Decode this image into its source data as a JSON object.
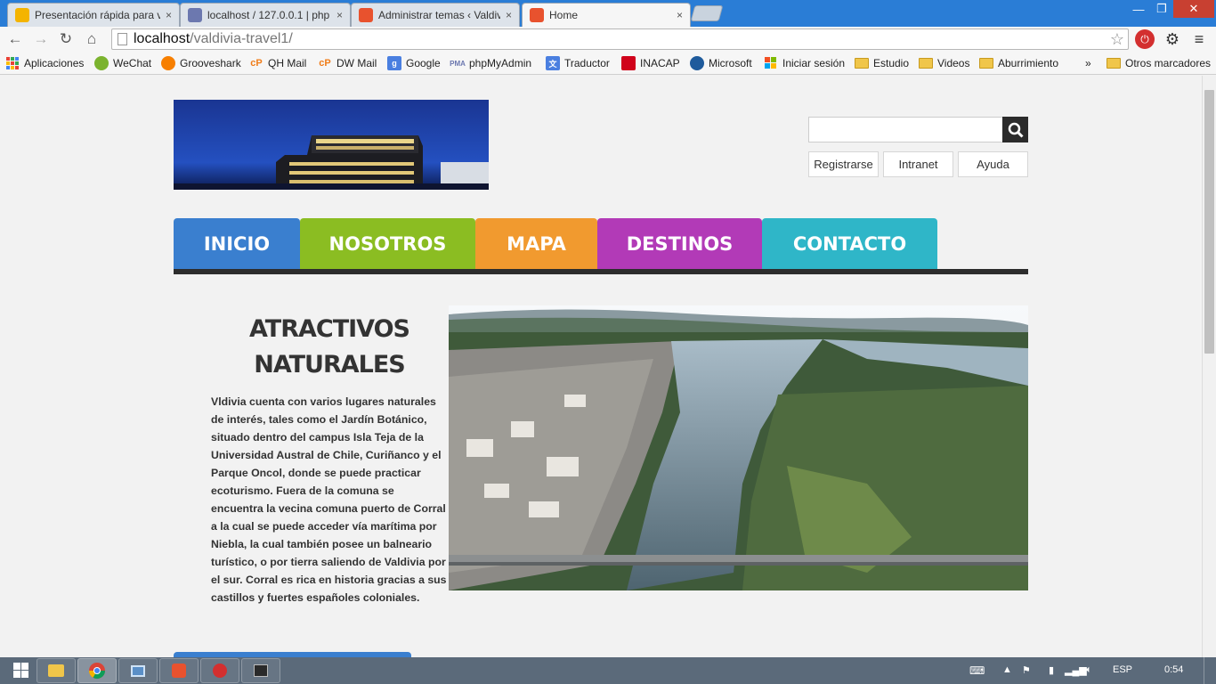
{
  "browser": {
    "tabs": [
      {
        "title": "Presentación rápida para v",
        "icon": "slides-icon",
        "color": "#f4b400"
      },
      {
        "title": "localhost / 127.0.0.1 | php",
        "icon": "phpmyadmin-icon",
        "color": "#6c78af"
      },
      {
        "title": "Administrar temas ‹ Valdiv",
        "icon": "xampp-icon",
        "color": "#e8522e"
      },
      {
        "title": "Home",
        "icon": "xampp-icon",
        "color": "#e8522e",
        "active": true
      }
    ],
    "tab_close_glyph": "×",
    "address": {
      "host": "localhost",
      "path": "/valdivia-travel1/"
    },
    "bookmarks": [
      {
        "label": "Aplicaciones",
        "icon": "apps-grid-icon"
      },
      {
        "label": "WeChat",
        "icon": "wechat-icon"
      },
      {
        "label": "Grooveshark",
        "icon": "grooveshark-icon"
      },
      {
        "label": "QH Mail",
        "icon": "cpanel-icon"
      },
      {
        "label": "DW Mail",
        "icon": "cpanel-icon"
      },
      {
        "label": "Google",
        "icon": "google-icon"
      },
      {
        "label": "phpMyAdmin",
        "icon": "phpmyadmin-icon"
      },
      {
        "label": "Traductor",
        "icon": "translate-icon"
      },
      {
        "label": "INACAP",
        "icon": "inacap-icon"
      },
      {
        "label": "Microsoft",
        "icon": "microsoft-icon"
      },
      {
        "label": "Iniciar sesión",
        "icon": "windows-icon"
      },
      {
        "label": "Estudio",
        "icon": "folder-icon"
      },
      {
        "label": "Videos",
        "icon": "folder-icon"
      },
      {
        "label": "Aburrimiento",
        "icon": "folder-icon"
      }
    ],
    "overflow_label": "»",
    "other_bookmarks": "Otros marcadores"
  },
  "site": {
    "links": {
      "register": "Registrarse",
      "intranet": "Intranet",
      "help": "Ayuda"
    },
    "nav": [
      {
        "label": "INICIO",
        "color": "#3a7fcf"
      },
      {
        "label": "NOSOTROS",
        "color": "#8bbd22"
      },
      {
        "label": "MAPA",
        "color": "#f19a2f"
      },
      {
        "label": "DESTINOS",
        "color": "#b23ab7"
      },
      {
        "label": "CONTACTO",
        "color": "#2fb6c8"
      }
    ],
    "section": {
      "title_line1": "ATRACTIVOS",
      "title_line2": "NATURALES",
      "body": "Vldivia cuenta con varios lugares naturales de interés, tales como el Jardín Botánico, situado dentro del campus Isla Teja de la Universidad Austral de Chile, Curiñanco y el Parque Oncol, donde se puede practicar ecoturismo. Fuera de la comuna se encuentra la vecina comuna puerto de Corral a la cual se puede acceder vía marítima por Niebla, la cual también posee un balneario turístico, o por tierra saliendo de Valdivia por el sur. Corral es rica en historia gracias a sus castillos y fuertes españoles coloniales."
    }
  },
  "taskbar": {
    "language": "ESP",
    "time": "0:54",
    "apps": [
      "explorer-icon",
      "chrome-icon",
      "window-icon",
      "xampp-icon",
      "shield-icon",
      "terminal-icon"
    ]
  }
}
